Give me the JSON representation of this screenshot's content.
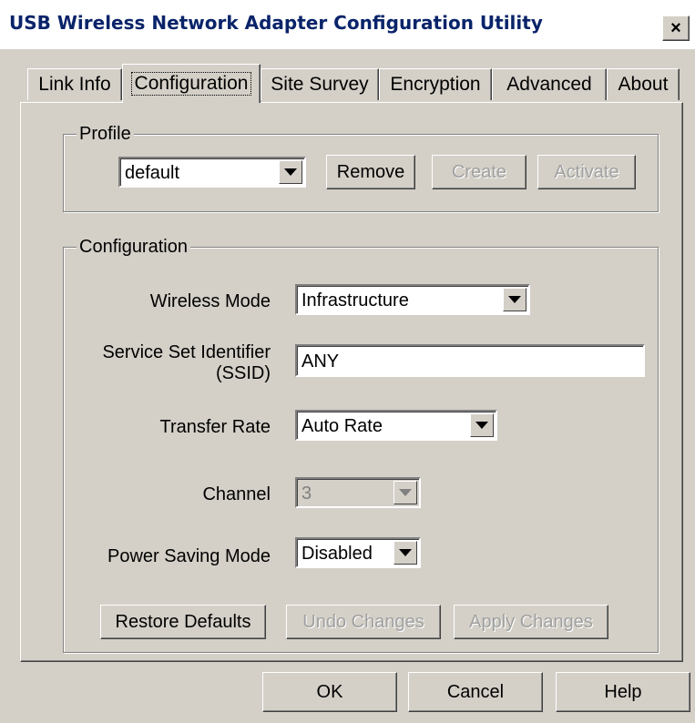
{
  "window": {
    "title": "USB Wireless Network Adapter Configuration Utility",
    "close_label": "×"
  },
  "tabs": [
    {
      "label": "Link Info"
    },
    {
      "label": "Configuration"
    },
    {
      "label": "Site Survey"
    },
    {
      "label": "Encryption"
    },
    {
      "label": "Advanced"
    },
    {
      "label": "About"
    }
  ],
  "active_tab": "Configuration",
  "profile": {
    "legend": "Profile",
    "selected": "default",
    "remove_label": "Remove",
    "create_label": "Create",
    "activate_label": "Activate"
  },
  "configuration": {
    "legend": "Configuration",
    "wireless_mode_label": "Wireless Mode",
    "wireless_mode_value": "Infrastructure",
    "ssid_label_line1": "Service Set Identifier",
    "ssid_label_line2": "(SSID)",
    "ssid_value": "ANY",
    "transfer_rate_label": "Transfer Rate",
    "transfer_rate_value": "Auto Rate",
    "channel_label": "Channel",
    "channel_value": "3",
    "power_saving_label": "Power Saving Mode",
    "power_saving_value": "Disabled",
    "restore_defaults_label": "Restore Defaults",
    "undo_changes_label": "Undo Changes",
    "apply_changes_label": "Apply Changes"
  },
  "footer": {
    "ok_label": "OK",
    "cancel_label": "Cancel",
    "help_label": "Help"
  },
  "colors": {
    "title_text": "#0a246a",
    "face": "#d4d0c8",
    "disabled_text": "#a0a0a0"
  }
}
